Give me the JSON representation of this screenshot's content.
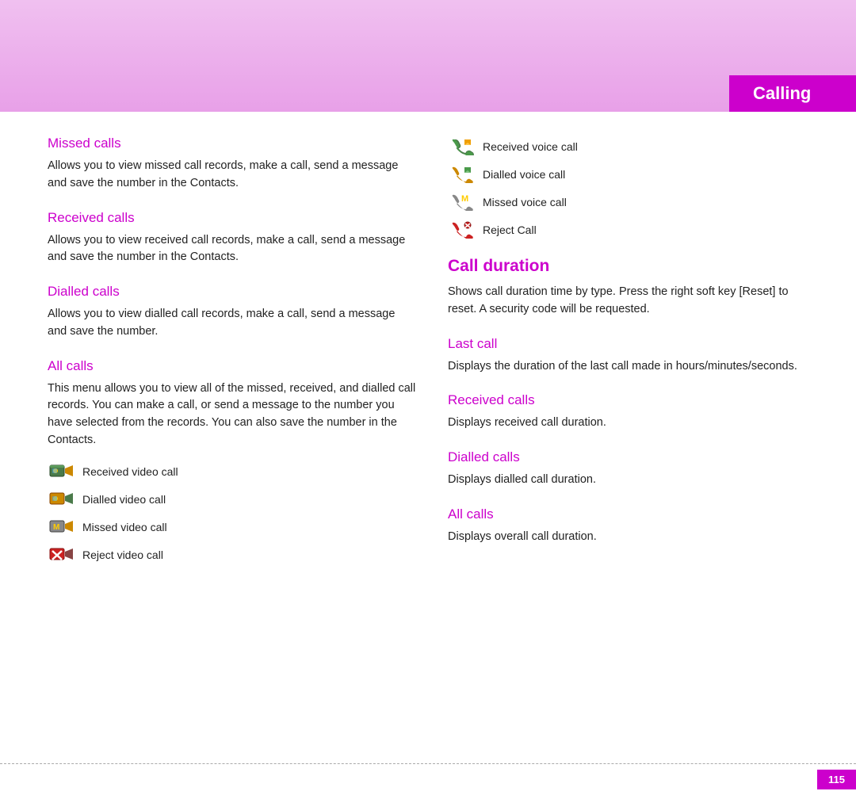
{
  "header": {
    "title": "Calling"
  },
  "left_column": {
    "sections": [
      {
        "id": "missed-calls",
        "title": "Missed calls",
        "body": "Allows you to view missed call records, make a call, send a message and save the number in the Contacts."
      },
      {
        "id": "received-calls",
        "title": "Received calls",
        "body": "Allows you to view received call records, make a call, send a message and save the number in the Contacts."
      },
      {
        "id": "dialled-calls",
        "title": "Dialled calls",
        "body": "Allows you to view dialled call records, make a call, send a message and save the number."
      },
      {
        "id": "all-calls",
        "title": "All calls",
        "body": "This menu allows you to view all of the missed, received, and dialled call records. You can make a call, or send a message to the number you have selected from the records. You can also save the number in the Contacts."
      }
    ],
    "icon_list": [
      {
        "icon": "received-video",
        "label": "Received video call"
      },
      {
        "icon": "dialled-video",
        "label": "Dialled video call"
      },
      {
        "icon": "missed-video",
        "label": "Missed video call"
      },
      {
        "icon": "reject-video",
        "label": "Reject video call"
      }
    ]
  },
  "right_column": {
    "icon_list": [
      {
        "icon": "received-voice",
        "label": "Received voice call"
      },
      {
        "icon": "dialled-voice",
        "label": "Dialled voice call"
      },
      {
        "icon": "missed-voice",
        "label": "Missed voice call"
      },
      {
        "icon": "reject-call",
        "label": "Reject Call"
      }
    ],
    "call_duration": {
      "title": "Call duration",
      "body": "Shows call duration time by type. Press the right soft key [Reset] to reset. A security code will be requested."
    },
    "sections": [
      {
        "id": "last-call",
        "title": "Last call",
        "body": "Displays the duration of the last call made in hours/minutes/seconds."
      },
      {
        "id": "received-calls-duration",
        "title": "Received calls",
        "body": "Displays received call duration."
      },
      {
        "id": "dialled-calls-duration",
        "title": "Dialled calls",
        "body": "Displays dialled call duration."
      },
      {
        "id": "all-calls-duration",
        "title": "All calls",
        "body": "Displays overall call duration."
      }
    ]
  },
  "footer": {
    "page_number": "115"
  }
}
